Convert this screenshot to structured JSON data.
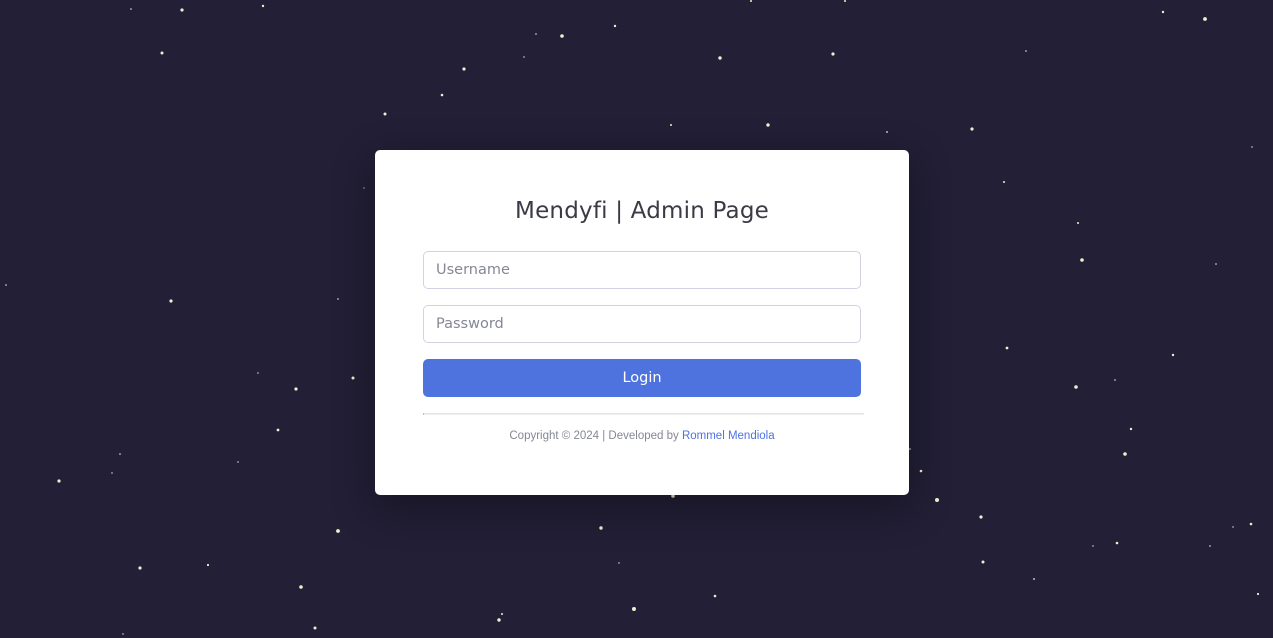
{
  "page": {
    "title": "Mendyfi | Admin Page"
  },
  "form": {
    "username_placeholder": "Username",
    "username_value": "",
    "password_placeholder": "Password",
    "password_value": "",
    "login_label": "Login"
  },
  "footer": {
    "copyright": "Copyright © 2024 | Developed by ",
    "developer_link": "Rommel Mendiola"
  },
  "colors": {
    "background": "#221f36",
    "card": "#ffffff",
    "primary": "#4e73df",
    "title_text": "#3a3b45",
    "muted_text": "#858796"
  }
}
